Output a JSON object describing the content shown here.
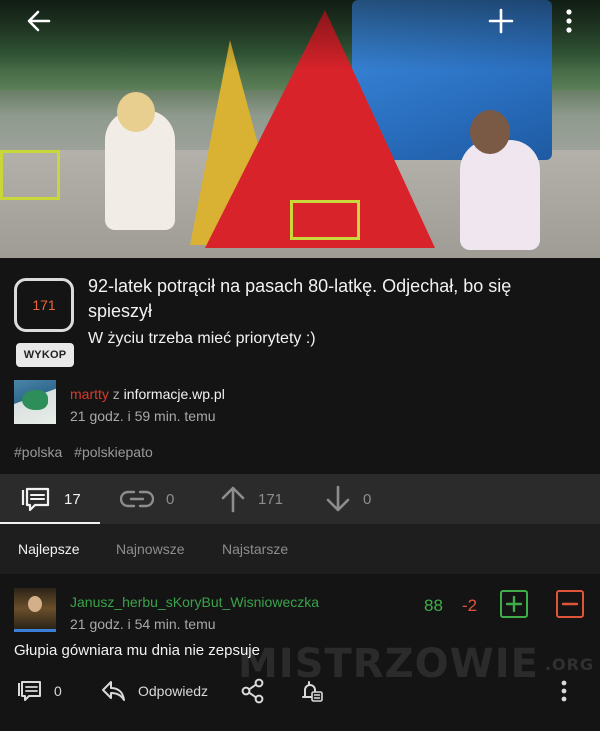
{
  "hero": {
    "alt": ""
  },
  "article": {
    "vote_count": "171",
    "wykop_label": "WYKOP",
    "title": "92-latek potrącił na pasach 80-latkę. Odjechał, bo się spieszył",
    "description": "W życiu trzeba mieć priorytety :)",
    "author": "martty",
    "z": "z",
    "source": "informacje.wp.pl",
    "time": "21 godz. i 59 min. temu",
    "tags": [
      "#polska",
      "#polskiepato"
    ]
  },
  "stats": {
    "comments": "17",
    "links": "0",
    "up": "171",
    "down": "0"
  },
  "sort": {
    "tabs": [
      "Najlepsze",
      "Najnowsze",
      "Najstarsze"
    ],
    "active": "Najlepsze"
  },
  "comment": {
    "author": "Janusz_herbu_sKoryBut_Wisnioweczka",
    "time": "21 godz. i 54 min. temu",
    "plus_count": "88",
    "minus_count": "-2",
    "text": "Głupia gówniara mu dnia nie zepsuje",
    "reply_count": "0",
    "reply_label": "Odpowiedz",
    "watermark": "MISTRZOWIE",
    "watermark_suffix": ".ORG"
  },
  "colors": {
    "accent_orange": "#e8673a",
    "author_red": "#d83a2a",
    "comment_author_green": "#3aa24a",
    "plus_green": "#3fae4a",
    "minus_red": "#e0553a"
  },
  "icons": [
    "back-arrow-icon",
    "plus-icon",
    "more-vertical-icon",
    "comments-icon",
    "link-icon",
    "arrow-up-icon",
    "arrow-down-icon",
    "reply-icon",
    "share-icon",
    "bell-icon"
  ]
}
